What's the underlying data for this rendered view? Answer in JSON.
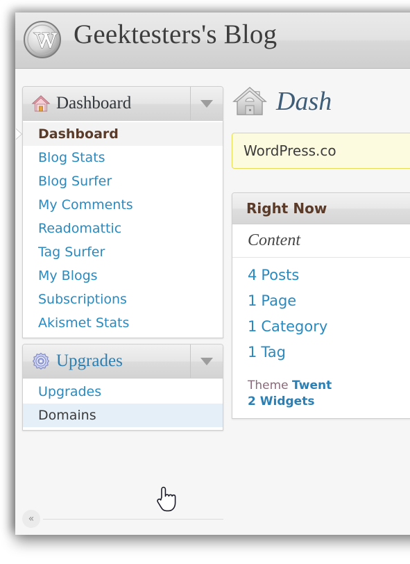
{
  "header": {
    "logo_icon": "wordpress-logo-icon",
    "blog_title": "Geektesters's Blog"
  },
  "sidebar": {
    "sections": [
      {
        "icon": "house-icon",
        "label": "Dashboard",
        "expander_icon": "chevron-down-icon",
        "items": [
          {
            "label": "Dashboard",
            "state": "current"
          },
          {
            "label": "Blog Stats",
            "state": "normal"
          },
          {
            "label": "Blog Surfer",
            "state": "normal"
          },
          {
            "label": "My Comments",
            "state": "normal"
          },
          {
            "label": "Readomattic",
            "state": "normal"
          },
          {
            "label": "Tag Surfer",
            "state": "normal"
          },
          {
            "label": "My Blogs",
            "state": "normal"
          },
          {
            "label": "Subscriptions",
            "state": "normal"
          },
          {
            "label": "Akismet Stats",
            "state": "normal"
          }
        ]
      },
      {
        "icon": "gear-icon",
        "label": "Upgrades",
        "expander_icon": "chevron-down-icon",
        "items": [
          {
            "label": "Upgrades",
            "state": "normal"
          },
          {
            "label": "Domains",
            "state": "hovered"
          }
        ]
      }
    ],
    "collapse_label": "«"
  },
  "main": {
    "page_icon": "house-icon",
    "page_title": "Dash",
    "notice": {
      "text": "WordPress.co"
    },
    "widget": {
      "title": "Right Now",
      "subhead": "Content",
      "stats": [
        {
          "count": "4",
          "label": "Posts"
        },
        {
          "count": "1",
          "label": "Page"
        },
        {
          "count": "1",
          "label": "Category"
        },
        {
          "count": "1",
          "label": "Tag"
        }
      ],
      "theme_prefix": "Theme ",
      "theme_name": "Twent",
      "widgets_line": "2 Widgets"
    }
  },
  "cursor": {
    "icon": "pointing-hand-cursor"
  },
  "colors": {
    "link_blue": "#2a8ac0",
    "current_brown": "#5a3a28",
    "notice_bg": "#fdfbdf",
    "notice_border": "#e6db55",
    "hover_bg": "#e4eff7"
  }
}
